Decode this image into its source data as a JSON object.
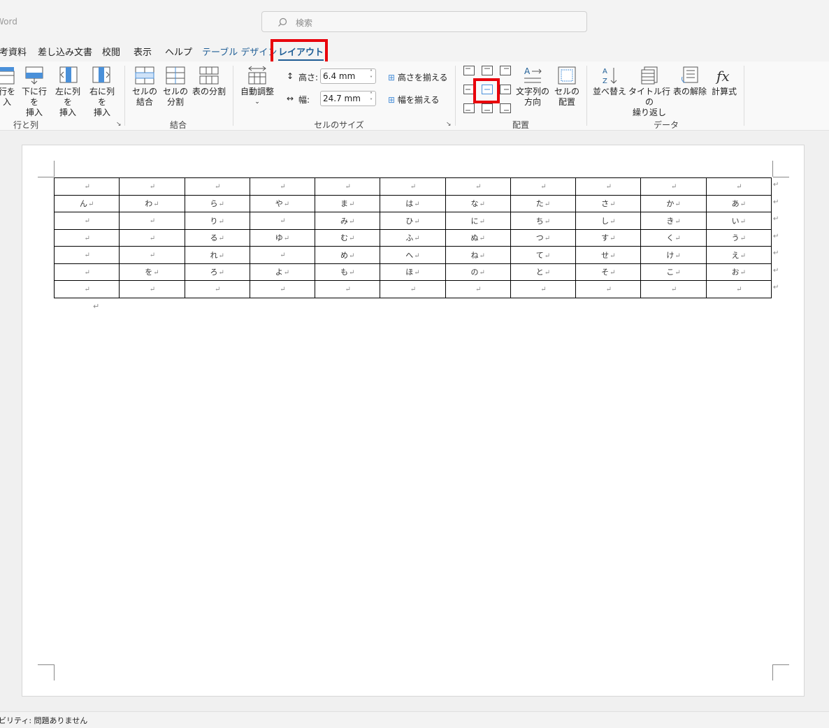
{
  "titlebar": {
    "app_name": "Word",
    "search_placeholder": "検索"
  },
  "tabs": [
    {
      "label": "参考資料"
    },
    {
      "label": "差し込み文書"
    },
    {
      "label": "校閲"
    },
    {
      "label": "表示"
    },
    {
      "label": "ヘルプ"
    },
    {
      "label": "テーブル デザイン"
    },
    {
      "label": "レイアウト",
      "active": true
    }
  ],
  "ribbon": {
    "rows_cols": {
      "label": "行と列",
      "insert_above_l1": "行を",
      "insert_above_l2": "入",
      "insert_below_l1": "下に行を",
      "insert_below_l2": "挿入",
      "insert_left_l1": "左に列を",
      "insert_left_l2": "挿入",
      "insert_right_l1": "右に列を",
      "insert_right_l2": "挿入"
    },
    "merge": {
      "label": "結合",
      "merge_cells_l1": "セルの",
      "merge_cells_l2": "結合",
      "split_cells_l1": "セルの",
      "split_cells_l2": "分割",
      "split_table": "表の分割"
    },
    "cell_size": {
      "label": "セルのサイズ",
      "autofit": "自動調整",
      "height_label": "高さ:",
      "height_value": "6.4 mm",
      "width_label": "幅:",
      "width_value": "24.7 mm",
      "distribute_rows": "高さを揃える",
      "distribute_cols": "幅を揃える"
    },
    "alignment": {
      "label": "配置",
      "text_direction_l1": "文字列の",
      "text_direction_l2": "方向",
      "cell_margins_l1": "セルの",
      "cell_margins_l2": "配置"
    },
    "data": {
      "label": "データ",
      "sort": "並べ替え",
      "repeat_header_l1": "タイトル行の",
      "repeat_header_l2": "繰り返し",
      "convert_to_text": "表の解除",
      "formula": "計算式"
    }
  },
  "document": {
    "table_rows": [
      [
        "",
        "",
        "",
        "",
        "",
        "",
        "",
        "",
        "",
        "",
        ""
      ],
      [
        "ん",
        "わ",
        "ら",
        "や",
        "ま",
        "は",
        "な",
        "た",
        "さ",
        "か",
        "あ"
      ],
      [
        "",
        "",
        "り",
        "",
        "み",
        "ひ",
        "に",
        "ち",
        "し",
        "き",
        "い"
      ],
      [
        "",
        "",
        "る",
        "ゆ",
        "む",
        "ふ",
        "ぬ",
        "つ",
        "す",
        "く",
        "う"
      ],
      [
        "",
        "",
        "れ",
        "",
        "め",
        "へ",
        "ね",
        "て",
        "せ",
        "け",
        "え"
      ],
      [
        "",
        "を",
        "ろ",
        "よ",
        "も",
        "ほ",
        "の",
        "と",
        "そ",
        "こ",
        "お"
      ],
      [
        "",
        "",
        "",
        "",
        "",
        "",
        "",
        "",
        "",
        "",
        ""
      ]
    ],
    "cell_mark": "↵"
  },
  "statusbar": {
    "accessibility": "ビリティ: 問題ありません"
  },
  "colors": {
    "accent": "#1f5e96",
    "highlight": "#e8000b"
  }
}
